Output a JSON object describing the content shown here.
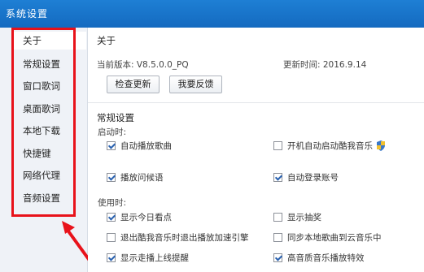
{
  "window": {
    "title": "系统设置"
  },
  "sidebar": {
    "items": [
      {
        "label": "关于",
        "active": true
      },
      {
        "label": "常规设置",
        "active": false
      },
      {
        "label": "窗口歌词",
        "active": false
      },
      {
        "label": "桌面歌词",
        "active": false
      },
      {
        "label": "本地下载",
        "active": false
      },
      {
        "label": "快捷键",
        "active": false
      },
      {
        "label": "网络代理",
        "active": false
      },
      {
        "label": "音频设置",
        "active": false
      }
    ]
  },
  "about": {
    "title": "关于",
    "version": "当前版本: V8.5.0.0_PQ",
    "update_time": "更新时间: 2016.9.14",
    "check_update_label": "检查更新",
    "feedback_label": "我要反馈"
  },
  "general": {
    "title": "常规设置",
    "startup": {
      "label": "启动时:",
      "options": [
        {
          "label": "自动播放歌曲",
          "checked": true
        },
        {
          "label": "开机自动启动酷我音乐",
          "checked": false
        },
        {
          "label": "播放问候语",
          "checked": true
        },
        {
          "label": "自动登录账号",
          "checked": true
        }
      ]
    },
    "usage": {
      "label": "使用时:",
      "options": [
        {
          "label": "显示今日看点",
          "checked": true
        },
        {
          "label": "显示抽奖",
          "checked": false
        },
        {
          "label": "退出酷我音乐时退出播放加速引擎",
          "checked": false
        },
        {
          "label": "同步本地歌曲到云音乐中",
          "checked": false
        },
        {
          "label": "显示走播上线提醒",
          "checked": true
        },
        {
          "label": "高音质音乐播放特效",
          "checked": true
        }
      ]
    }
  },
  "colors": {
    "highlight": "#e8121a",
    "titlebar": "#1e7fd4"
  },
  "icons": {
    "uac": "shield-icon",
    "annotation": "arrow-icon"
  }
}
